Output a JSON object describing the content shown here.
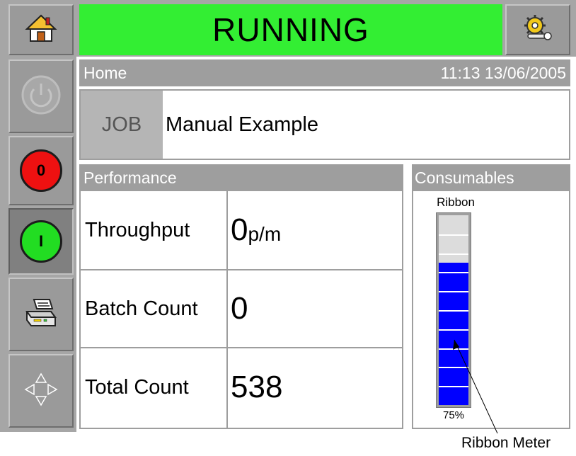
{
  "status": {
    "label": "RUNNING",
    "color": "#33ee33"
  },
  "header": {
    "page": "Home",
    "datetime": "11:13 13/06/2005"
  },
  "job": {
    "label": "JOB",
    "name": "Manual Example"
  },
  "performance": {
    "title": "Performance",
    "rows": [
      {
        "label": "Throughput",
        "value": "0",
        "unit": "p/m"
      },
      {
        "label": "Batch Count",
        "value": "0",
        "unit": ""
      },
      {
        "label": "Total Count",
        "value": "538",
        "unit": ""
      }
    ]
  },
  "consumables": {
    "title": "Consumables",
    "ribbon": {
      "label": "Ribbon",
      "percent_label": "75%",
      "level": 0.75,
      "color": "#0000ff"
    }
  },
  "annotation": {
    "label": "Ribbon Meter"
  },
  "sidebar": {
    "stop_label": "0",
    "start_label": "I",
    "stop_color": "#ee1111",
    "start_color": "#22dd22"
  },
  "icons": [
    "home-icon",
    "settings-icon",
    "power-icon",
    "print-icon",
    "navigate-icon"
  ]
}
